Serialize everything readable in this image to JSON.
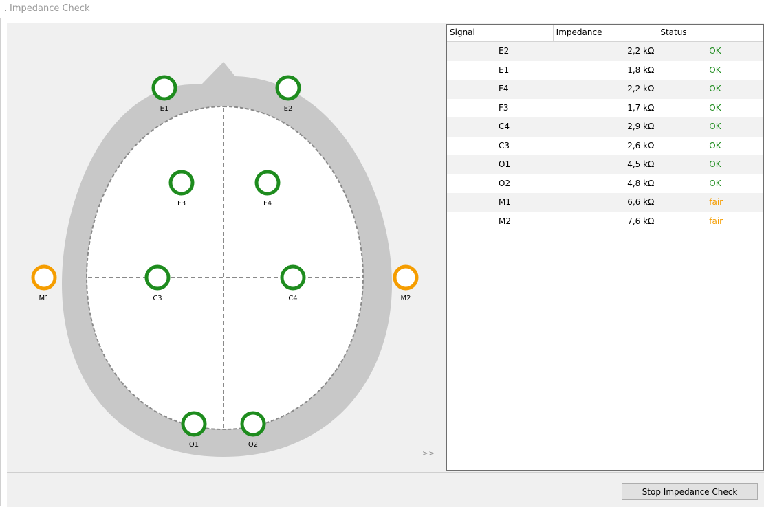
{
  "window": {
    "title": "Impedance Check"
  },
  "colors": {
    "ok": "#1e8c1e",
    "fair": "#f59d00",
    "head_fill": "#c8c8c8"
  },
  "head_view": {
    "electrodes": [
      {
        "label": "E1",
        "status": "ok"
      },
      {
        "label": "E2",
        "status": "ok"
      },
      {
        "label": "F3",
        "status": "ok"
      },
      {
        "label": "F4",
        "status": "ok"
      },
      {
        "label": "M1",
        "status": "fair"
      },
      {
        "label": "C3",
        "status": "ok"
      },
      {
        "label": "C4",
        "status": "ok"
      },
      {
        "label": "M2",
        "status": "fair"
      },
      {
        "label": "O1",
        "status": "ok"
      },
      {
        "label": "O2",
        "status": "ok"
      }
    ],
    "expand_label": ">>"
  },
  "table": {
    "headers": {
      "signal": "Signal",
      "impedance": "Impedance",
      "status": "Status"
    },
    "rows": [
      {
        "signal": "E2",
        "impedance": "2,2 kΩ",
        "status": "OK"
      },
      {
        "signal": "E1",
        "impedance": "1,8 kΩ",
        "status": "OK"
      },
      {
        "signal": "F4",
        "impedance": "2,2 kΩ",
        "status": "OK"
      },
      {
        "signal": "F3",
        "impedance": "1,7 kΩ",
        "status": "OK"
      },
      {
        "signal": "C4",
        "impedance": "2,9 kΩ",
        "status": "OK"
      },
      {
        "signal": "C3",
        "impedance": "2,6 kΩ",
        "status": "OK"
      },
      {
        "signal": "O1",
        "impedance": "4,5 kΩ",
        "status": "OK"
      },
      {
        "signal": "O2",
        "impedance": "4,8 kΩ",
        "status": "OK"
      },
      {
        "signal": "M1",
        "impedance": "6,6 kΩ",
        "status": "fair"
      },
      {
        "signal": "M2",
        "impedance": "7,6 kΩ",
        "status": "fair"
      }
    ]
  },
  "footer": {
    "stop_button": "Stop Impedance Check"
  }
}
